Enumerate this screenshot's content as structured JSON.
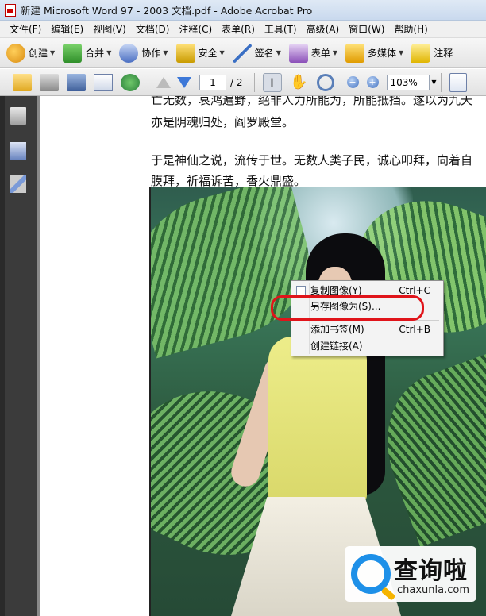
{
  "window": {
    "title": "新建 Microsoft Word 97 - 2003 文档.pdf - Adobe Acrobat Pro"
  },
  "menubar": [
    "文件(F)",
    "编辑(E)",
    "视图(V)",
    "文档(D)",
    "注释(C)",
    "表单(R)",
    "工具(T)",
    "高级(A)",
    "窗口(W)",
    "帮助(H)"
  ],
  "toolbar1": {
    "create": "创建",
    "merge": "合并",
    "collaborate": "协作",
    "secure": "安全",
    "sign": "签名",
    "forms": "表单",
    "multimedia": "多媒体",
    "comment": "注释"
  },
  "toolbar2": {
    "page_current": "1",
    "page_total": "/ 2",
    "zoom": "103%"
  },
  "document": {
    "lines": [
      "亡无数，哀鸿遍野，绝非人力所能为，所能抵挡。遂以为九天",
      "亦是阴魂归处，阎罗殿堂。",
      "于是神仙之说，流传于世。无数人类子民，诚心叩拜，向着自",
      "膜拜，祈福诉苦，香火鼎盛。"
    ]
  },
  "context_menu": {
    "items": [
      {
        "label": "复制图像(Y)",
        "shortcut": "Ctrl+C"
      },
      {
        "label": "另存图像为(S)...",
        "shortcut": ""
      },
      {
        "label": "添加书签(M)",
        "shortcut": "Ctrl+B"
      },
      {
        "label": "创建链接(A)",
        "shortcut": ""
      }
    ],
    "highlight_color": "#e0141a"
  },
  "watermark": {
    "brand": "查询啦",
    "url": "chaxunla.com"
  }
}
